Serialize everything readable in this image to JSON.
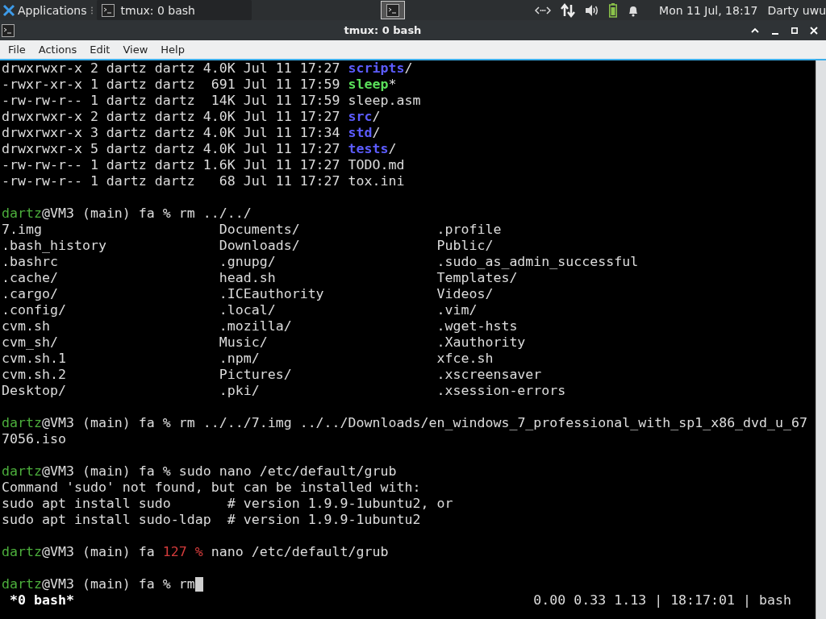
{
  "panel": {
    "apps_label": "Applications",
    "tasks": [
      {
        "label": "tmux: 0 bash",
        "selected": false
      }
    ],
    "clock": "Mon 11 Jul, 18:17",
    "user": "Darty uwu"
  },
  "window": {
    "title": "tmux: 0 bash"
  },
  "menu": [
    "File",
    "Actions",
    "Edit",
    "View",
    "Help"
  ],
  "terminal": {
    "lines": [
      {
        "kind": "text",
        "segments": [
          {
            "text": "drwxrwxr-x 2 dartz dartz 4.0K Jul 11 17:27 ",
            "kind": "plain"
          },
          {
            "text": "scripts",
            "kind": "dir"
          },
          {
            "text": "/",
            "kind": "plain"
          }
        ]
      },
      {
        "kind": "text",
        "segments": [
          {
            "text": "-rwxr-xr-x 1 dartz dartz  691 Jul 11 17:59 ",
            "kind": "plain"
          },
          {
            "text": "sleep",
            "kind": "exec"
          },
          {
            "text": "*",
            "kind": "plain"
          }
        ]
      },
      {
        "kind": "text",
        "segments": [
          {
            "text": "-rw-rw-r-- 1 dartz dartz  14K Jul 11 17:59 sleep.asm",
            "kind": "plain"
          }
        ]
      },
      {
        "kind": "text",
        "segments": [
          {
            "text": "drwxrwxr-x 2 dartz dartz 4.0K Jul 11 17:27 ",
            "kind": "plain"
          },
          {
            "text": "src",
            "kind": "dir"
          },
          {
            "text": "/",
            "kind": "plain"
          }
        ]
      },
      {
        "kind": "text",
        "segments": [
          {
            "text": "drwxrwxr-x 3 dartz dartz 4.0K Jul 11 17:34 ",
            "kind": "plain"
          },
          {
            "text": "std",
            "kind": "dir"
          },
          {
            "text": "/",
            "kind": "plain"
          }
        ]
      },
      {
        "kind": "text",
        "segments": [
          {
            "text": "drwxrwxr-x 5 dartz dartz 4.0K Jul 11 17:27 ",
            "kind": "plain"
          },
          {
            "text": "tests",
            "kind": "dir"
          },
          {
            "text": "/",
            "kind": "plain"
          }
        ]
      },
      {
        "kind": "text",
        "segments": [
          {
            "text": "-rw-rw-r-- 1 dartz dartz 1.6K Jul 11 17:27 TODO.md",
            "kind": "plain"
          }
        ]
      },
      {
        "kind": "text",
        "segments": [
          {
            "text": "-rw-rw-r-- 1 dartz dartz   68 Jul 11 17:27 tox.ini",
            "kind": "plain"
          }
        ]
      },
      {
        "kind": "blank"
      },
      {
        "kind": "text",
        "segments": [
          {
            "text": "dartz",
            "kind": "user"
          },
          {
            "text": "@VM3 (main) fa % rm ../../",
            "kind": "plain"
          }
        ]
      },
      {
        "kind": "columns",
        "cells": [
          "7.img",
          "Documents/",
          ".profile"
        ]
      },
      {
        "kind": "columns",
        "cells": [
          ".bash_history",
          "Downloads/",
          "Public/"
        ]
      },
      {
        "kind": "columns",
        "cells": [
          ".bashrc",
          ".gnupg/",
          ".sudo_as_admin_successful"
        ]
      },
      {
        "kind": "columns",
        "cells": [
          ".cache/",
          "head.sh",
          "Templates/"
        ]
      },
      {
        "kind": "columns",
        "cells": [
          ".cargo/",
          ".ICEauthority",
          "Videos/"
        ]
      },
      {
        "kind": "columns",
        "cells": [
          ".config/",
          ".local/",
          ".vim/"
        ]
      },
      {
        "kind": "columns",
        "cells": [
          "cvm.sh",
          ".mozilla/",
          ".wget-hsts"
        ]
      },
      {
        "kind": "columns",
        "cells": [
          "cvm_sh/",
          "Music/",
          ".Xauthority"
        ]
      },
      {
        "kind": "columns",
        "cells": [
          "cvm.sh.1",
          ".npm/",
          "xfce.sh"
        ]
      },
      {
        "kind": "columns",
        "cells": [
          "cvm.sh.2",
          "Pictures/",
          ".xscreensaver"
        ]
      },
      {
        "kind": "columns",
        "cells": [
          "Desktop/",
          ".pki/",
          ".xsession-errors"
        ]
      },
      {
        "kind": "blank"
      },
      {
        "kind": "text",
        "segments": [
          {
            "text": "dartz",
            "kind": "user"
          },
          {
            "text": "@VM3 (main) fa % rm ../../7.img ../../Downloads/en_windows_7_professional_with_sp1_x86_dvd_u_67",
            "kind": "plain"
          }
        ]
      },
      {
        "kind": "text",
        "segments": [
          {
            "text": "7056.iso",
            "kind": "plain"
          }
        ]
      },
      {
        "kind": "blank"
      },
      {
        "kind": "text",
        "segments": [
          {
            "text": "dartz",
            "kind": "user"
          },
          {
            "text": "@VM3 (main) fa % sudo nano /etc/default/grub",
            "kind": "plain"
          }
        ]
      },
      {
        "kind": "text",
        "segments": [
          {
            "text": "Command 'sudo' not found, but can be installed with:",
            "kind": "plain"
          }
        ]
      },
      {
        "kind": "text",
        "segments": [
          {
            "text": "sudo apt install sudo       # version 1.9.9-1ubuntu2, or",
            "kind": "plain"
          }
        ]
      },
      {
        "kind": "text",
        "segments": [
          {
            "text": "sudo apt install sudo-ldap  # version 1.9.9-1ubuntu2",
            "kind": "plain"
          }
        ]
      },
      {
        "kind": "blank"
      },
      {
        "kind": "text",
        "segments": [
          {
            "text": "dartz",
            "kind": "user"
          },
          {
            "text": "@VM3 (main) fa ",
            "kind": "plain"
          },
          {
            "text": "127 %",
            "kind": "error"
          },
          {
            "text": " nano /etc/default/grub",
            "kind": "plain"
          }
        ]
      },
      {
        "kind": "blank"
      },
      {
        "kind": "text",
        "cursor": true,
        "segments": [
          {
            "text": "dartz",
            "kind": "user"
          },
          {
            "text": "@VM3 (main) fa % rm",
            "kind": "plain"
          }
        ]
      }
    ]
  },
  "status_bar": {
    "window": "*0 bash*",
    "info": "0.00 0.33 1.13 | 18:17:01 | bash"
  }
}
